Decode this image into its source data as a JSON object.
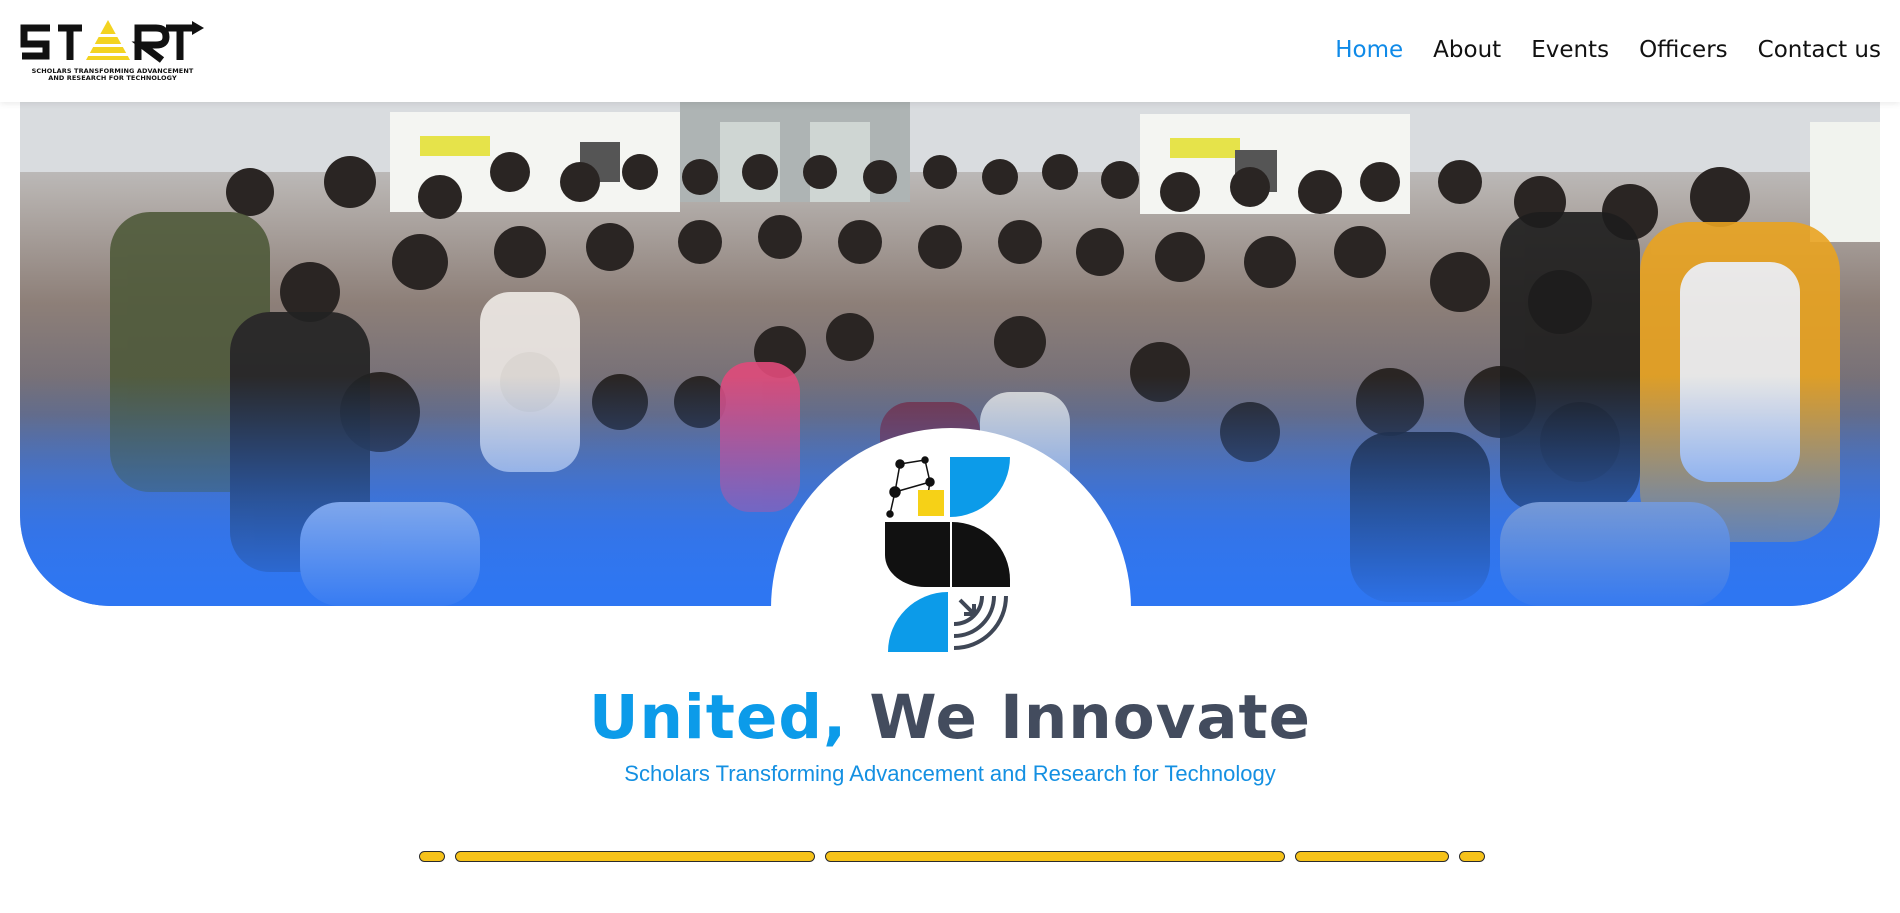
{
  "header": {
    "logo_text": "START",
    "logo_subtitle_line1": "SCHOLARS TRANSFORMING ADVANCEMENT",
    "logo_subtitle_line2": "AND RESEARCH FOR TECHNOLOGY",
    "nav": [
      {
        "label": "Home",
        "active": true
      },
      {
        "label": "About",
        "active": false
      },
      {
        "label": "Events",
        "active": false
      },
      {
        "label": "Officers",
        "active": false
      },
      {
        "label": "Contact us",
        "active": false
      }
    ]
  },
  "hero": {
    "image": "group-photo",
    "emblem": "start-s-emblem-icon"
  },
  "tagline": {
    "highlight": "United,",
    "rest": " We Innovate",
    "subtitle": "Scholars Transforming Advancement and Research for Technology"
  },
  "colors": {
    "accent_blue": "#0c9be9",
    "nav_active": "#0f8ae8",
    "title_dark": "#434c5e",
    "bar_yellow": "#f6c21a"
  },
  "decor_bars": 5
}
